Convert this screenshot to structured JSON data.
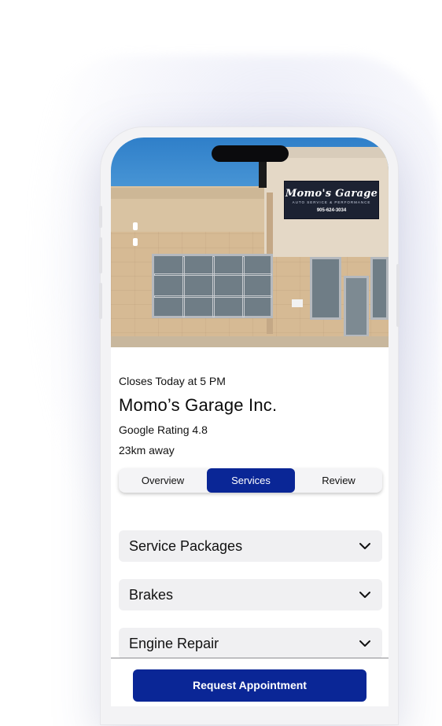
{
  "colors": {
    "accent": "#0a2696",
    "accordion_bg": "#f0f0f2",
    "text": "#111111"
  },
  "hero": {
    "sign_name": "Momo's Garage",
    "sign_subtitle": "AUTO SERVICE & PERFORMANCE",
    "sign_phone": "905-624-3034"
  },
  "business": {
    "hours": "Closes Today at 5 PM",
    "name": "Momo’s Garage Inc.",
    "rating": "Google Rating 4.8",
    "distance": "23km away"
  },
  "tabs": [
    {
      "label": "Overview",
      "active": false
    },
    {
      "label": "Services",
      "active": true
    },
    {
      "label": "Review",
      "active": false
    }
  ],
  "sections": [
    {
      "label": "Service Packages",
      "icon": "chevron-down-icon"
    },
    {
      "label": "Brakes",
      "icon": "chevron-down-icon"
    },
    {
      "label": "Engine Repair",
      "icon": "chevron-down-icon"
    }
  ],
  "cta": {
    "label": "Request Appointment"
  }
}
